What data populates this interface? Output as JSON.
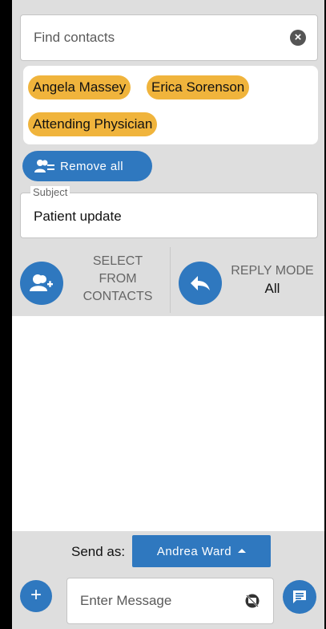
{
  "search": {
    "placeholder": "Find contacts"
  },
  "recipients": [
    "Angela Massey",
    "Erica Sorenson",
    "Attending Physician"
  ],
  "remove_all_label": "Remove all",
  "subject": {
    "label": "Subject",
    "value": "Patient update"
  },
  "select_contacts": {
    "line1": "SELECT",
    "line2": "FROM",
    "line3": "CONTACTS"
  },
  "reply_mode": {
    "label": "REPLY MODE",
    "value": "All"
  },
  "send_as": {
    "label": "Send as:",
    "value": "Andrea Ward"
  },
  "message": {
    "placeholder": "Enter Message"
  },
  "colors": {
    "accent": "#2f78bf",
    "chip": "#f0b43c",
    "panel": "#dedede"
  },
  "icons": {
    "clear": "clear-icon",
    "remove_all": "remove-users-icon",
    "select_contacts": "add-user-icon",
    "reply_mode": "reply-icon",
    "add": "plus-icon",
    "message_status": "message-off-icon",
    "send": "message-icon"
  }
}
